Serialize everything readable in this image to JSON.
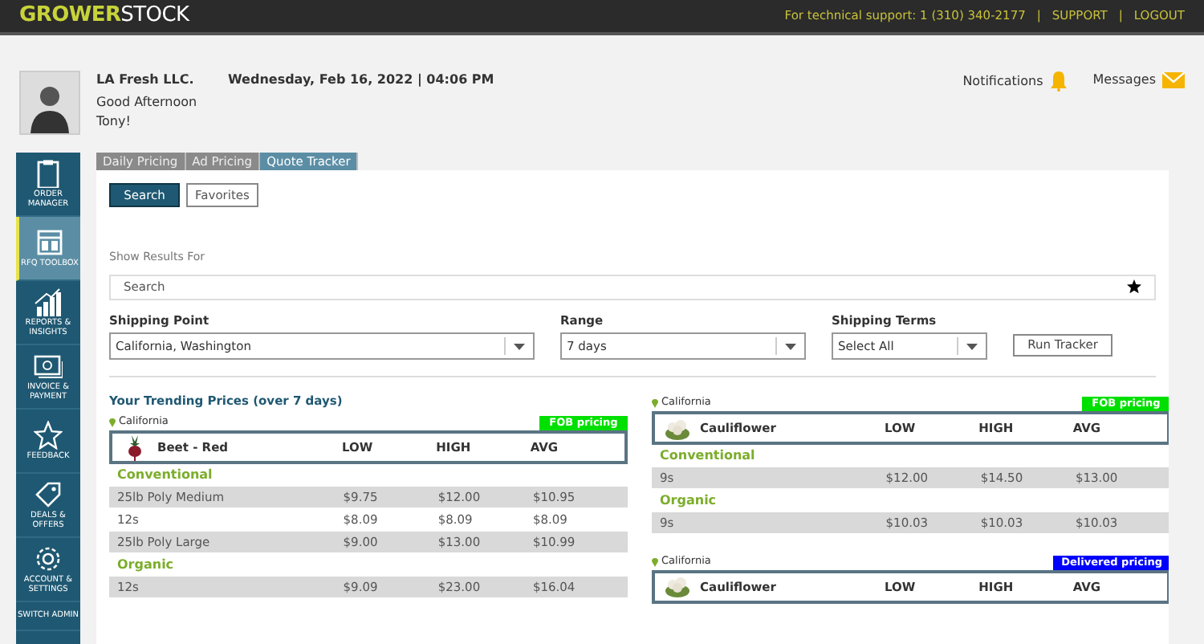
{
  "top_bar": {
    "logo_bold": "GROWER",
    "logo_light": "STOCK",
    "support": "For technical support: 1 (310) 340-2177",
    "separator": "|",
    "links": [
      "SUPPORT",
      "LOGOUT"
    ]
  },
  "header": {
    "company": "LA Fresh LLC.",
    "greeting": "Good Afternoon Tony!",
    "datetime": "Wednesday, Feb 16, 2022 | 04:06 PM",
    "notifications": "Notifications",
    "messages": "Messages"
  },
  "sidebar": {
    "items": [
      {
        "kind": "clipboard",
        "label": "ORDER MANAGER",
        "selected": false
      },
      {
        "kind": "layout",
        "label": "RFQ TOOLBOX",
        "selected": true
      },
      {
        "kind": "chart",
        "label": "REPORTS & INSIGHTS",
        "selected": false
      },
      {
        "kind": "money",
        "label": "INVOICE & PAYMENT",
        "selected": false
      },
      {
        "kind": "star",
        "label": "FEEDBACK",
        "selected": false
      },
      {
        "kind": "tag",
        "label": "DEALS & OFFERS",
        "selected": false
      },
      {
        "kind": "gear",
        "label": "ACCOUNT & SETTINGS",
        "selected": false
      },
      {
        "kind": "text",
        "label": "SWITCH ADMIN",
        "selected": false
      }
    ]
  },
  "tabs": [
    {
      "label": "Daily Pricing",
      "selected": false
    },
    {
      "label": "Ad Pricing",
      "selected": false
    },
    {
      "label": "Quote Tracker",
      "selected": true
    }
  ],
  "mode_buttons": [
    {
      "label": "Search",
      "selected": true
    },
    {
      "label": "Favorites",
      "selected": false
    }
  ],
  "show_results_label": "Show Results For",
  "search": {
    "placeholder": "Search"
  },
  "filters": [
    {
      "label": "Shipping Point",
      "value": "California, Washington"
    },
    {
      "label": "Range",
      "value": "7 days"
    },
    {
      "label": "Shipping Terms",
      "value": "Select All"
    }
  ],
  "run_button": "Run Tracker",
  "trending_title": "Your Trending Prices (over 7 days)",
  "cards": [
    {
      "location": "California",
      "pricing": "FOB pricing",
      "color": "#00e000",
      "product": "Beet - Red",
      "kind": "beet",
      "columns": [
        "LOW",
        "HIGH",
        "AVG"
      ],
      "groups": [
        {
          "name": "Conventional",
          "rows": [
            [
              "25lb Poly Medium",
              "$9.75",
              "$12.00",
              "$10.95"
            ],
            [
              "12s",
              "$8.09",
              "$8.09",
              "$8.09"
            ],
            [
              "25lb Poly Large",
              "$9.00",
              "$13.00",
              "$10.99"
            ]
          ]
        },
        {
          "name": "Organic",
          "rows": [
            [
              "12s",
              "$9.09",
              "$23.00",
              "$16.04"
            ]
          ]
        }
      ]
    },
    {
      "location": "California",
      "pricing": "FOB pricing",
      "color": "#00e000",
      "product": "Cauliflower",
      "kind": "cauliflower",
      "columns": [
        "LOW",
        "HIGH",
        "AVG"
      ],
      "groups": [
        {
          "name": "Conventional",
          "rows": [
            [
              "9s",
              "$12.00",
              "$14.50",
              "$13.00"
            ]
          ]
        },
        {
          "name": "Organic",
          "rows": [
            [
              "9s",
              "$10.03",
              "$10.03",
              "$10.03"
            ]
          ]
        }
      ]
    },
    {
      "location": "California",
      "pricing": "Delivered pricing",
      "color": "#0000ff",
      "product": "Cauliflower",
      "kind": "cauliflower",
      "columns": [
        "LOW",
        "HIGH",
        "AVG"
      ]
    }
  ]
}
